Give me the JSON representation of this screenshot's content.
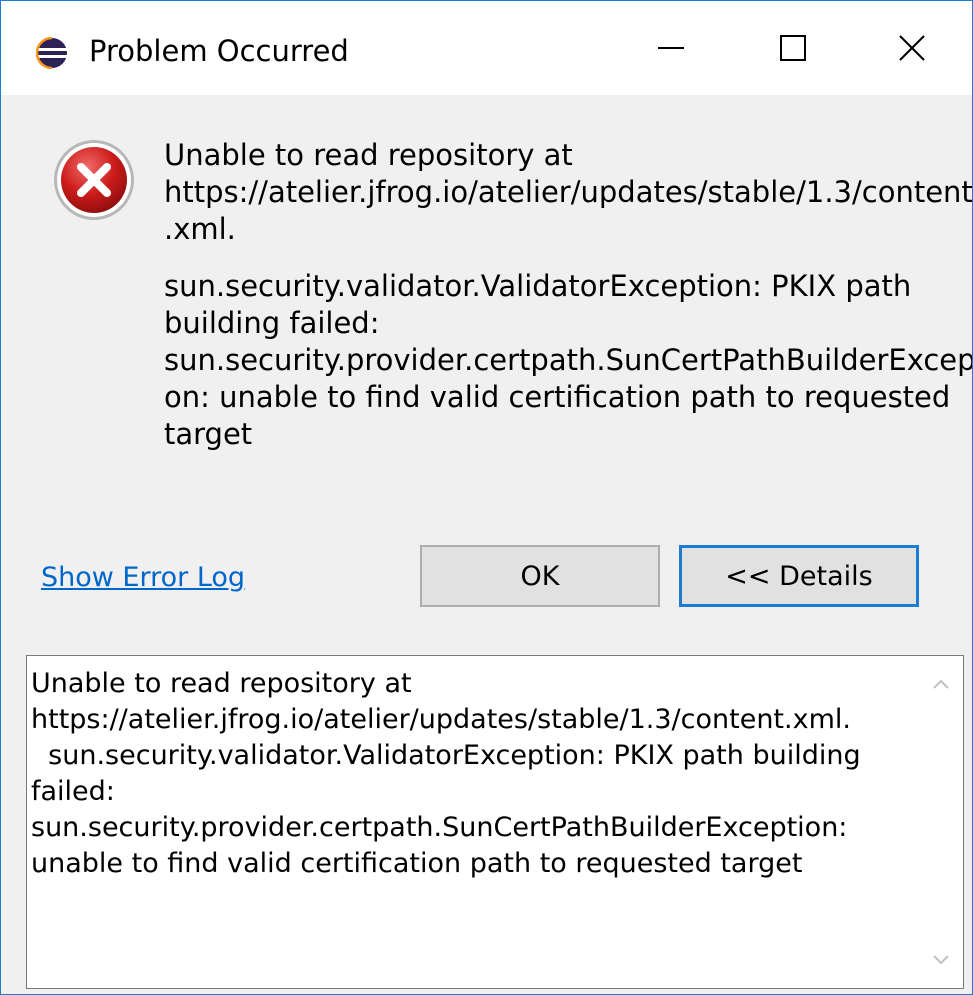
{
  "window": {
    "title": "Problem Occurred",
    "accent_color": "#1e7bd2"
  },
  "icons": {
    "app": "eclipse-icon",
    "error": "error-icon",
    "minimize": "minimize-icon",
    "maximize": "maximize-icon",
    "close": "close-icon",
    "scroll_up": "chevron-up-icon",
    "scroll_down": "chevron-down-icon"
  },
  "message": {
    "line1": "Unable to read repository at\nhttps://atelier.jfrog.io/atelier/updates/stable/1.3/content\n.xml.",
    "line2": "sun.security.validator.ValidatorException: PKIX path\nbuilding failed:\nsun.security.provider.certpath.SunCertPathBuilderExcepti\non: unable to find valid certification path to requested\ntarget"
  },
  "actions": {
    "show_error_log": "Show Error Log",
    "ok": "OK",
    "details": "<< Details"
  },
  "details": {
    "text": "Unable to read repository at\nhttps://atelier.jfrog.io/atelier/updates/stable/1.3/content.xml.\n  sun.security.validator.ValidatorException: PKIX path building\nfailed:\nsun.security.provider.certpath.SunCertPathBuilderException:\nunable to find valid certification path to requested target"
  }
}
